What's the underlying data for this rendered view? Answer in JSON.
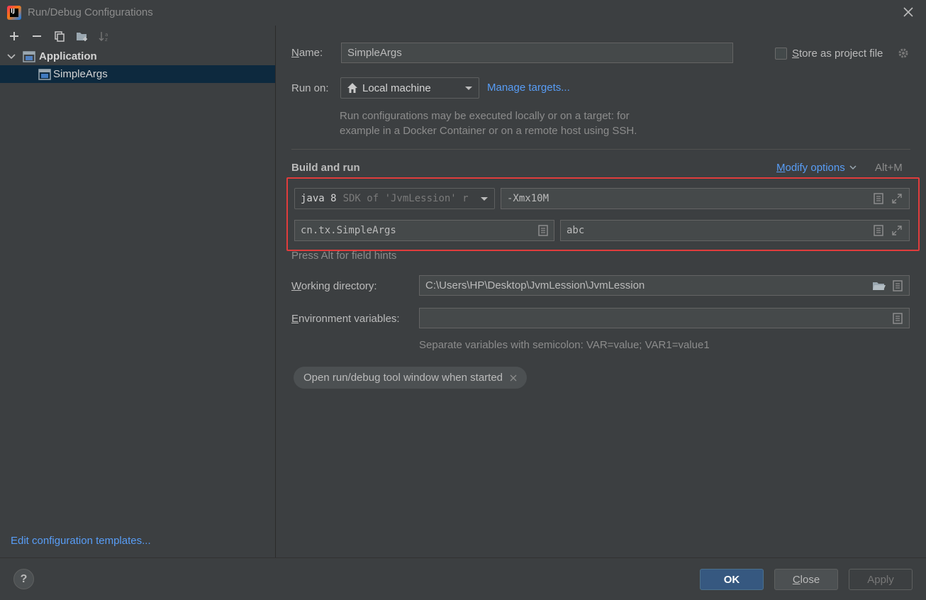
{
  "window": {
    "title": "Run/Debug Configurations"
  },
  "tree": {
    "group_label": "Application",
    "selected_item": "SimpleArgs"
  },
  "left_footer": {
    "edit_templates": "Edit configuration templates..."
  },
  "form": {
    "name_label_underline": "N",
    "name_label_rest": "ame:",
    "name_value": "SimpleArgs",
    "store_label_underline": "S",
    "store_label_rest": "tore as project file",
    "run_on_label": "Run on:",
    "run_on_value": "Local machine",
    "manage_targets": "Manage targets...",
    "run_on_hint_line1": "Run configurations may be executed locally or on a target: for",
    "run_on_hint_line2": "example in a Docker Container or on a remote host using SSH.",
    "section_title": "Build and run",
    "modify_options_underline": "M",
    "modify_options_rest": "odify options",
    "modify_shortcut": "Alt+M",
    "jdk_main": "java 8",
    "jdk_detail": "SDK of 'JvmLession' r",
    "vm_options": "-Xmx10M",
    "main_class": "cn.tx.SimpleArgs",
    "program_args": "abc",
    "field_hints": "Press Alt for field hints",
    "working_dir_label_underline": "W",
    "working_dir_label_rest": "orking directory:",
    "working_dir_value": "C:\\Users\\HP\\Desktop\\JvmLession\\JvmLession",
    "env_label_underline": "E",
    "env_label_rest": "nvironment variables:",
    "env_value": "",
    "env_hint": "Separate variables with semicolon: VAR=value; VAR1=value1",
    "chip_label": "Open run/debug tool window when started"
  },
  "buttons": {
    "help": "?",
    "ok": "OK",
    "close_underline": "C",
    "close_rest": "lose",
    "apply": "Apply"
  },
  "colors": {
    "background": "#3c3f41",
    "selection": "#0d293e",
    "link": "#589df6",
    "highlight_border": "#e03c3c",
    "ok_button": "#365880"
  }
}
